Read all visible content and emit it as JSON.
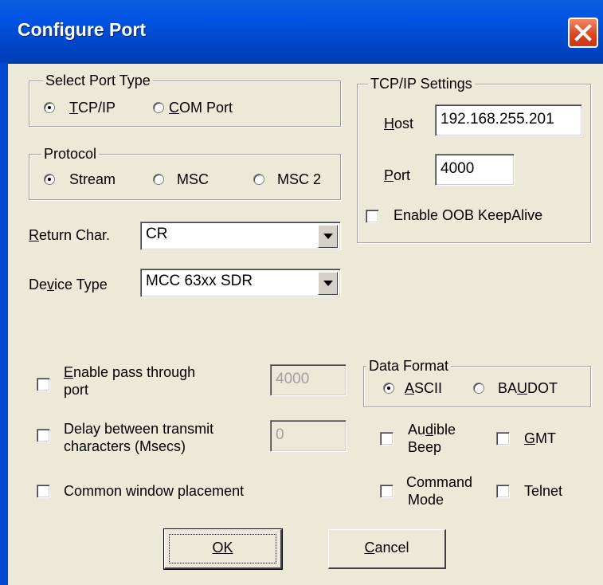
{
  "window": {
    "title": "Configure Port"
  },
  "port_type": {
    "legend": "Select Port Type",
    "options": [
      "TCP/IP",
      "COM Port"
    ],
    "selected": "TCP/IP"
  },
  "protocol": {
    "legend": "Protocol",
    "options": [
      "Stream",
      "MSC",
      "MSC 2"
    ],
    "selected": "Stream"
  },
  "return_char": {
    "label": "Return Char.",
    "value": "CR"
  },
  "device_type": {
    "label": "Device Type",
    "value": "MCC 63xx SDR"
  },
  "tcpip": {
    "legend": "TCP/IP Settings",
    "host_label": "Host",
    "host_value": "192.168.255.201",
    "port_label": "Port",
    "port_value": "4000",
    "oob_label": "Enable OOB KeepAlive",
    "oob_checked": false
  },
  "pass_through": {
    "label_line1": "Enable pass through",
    "label_line2": "port",
    "checked": false,
    "value": "4000"
  },
  "delay": {
    "label_line1": "Delay between transmit",
    "label_line2": "characters (Msecs)",
    "checked": false,
    "value": "0"
  },
  "common_window": {
    "label": "Common window placement",
    "checked": false
  },
  "data_format": {
    "legend": "Data Format",
    "options": [
      "ASCII",
      "BAUDOT"
    ],
    "selected": "ASCII"
  },
  "audible_beep": {
    "label_line1": "Audible",
    "label_line2": "Beep",
    "checked": false
  },
  "gmt": {
    "label": "GMT",
    "checked": false
  },
  "command_mode": {
    "label_line1": "Command",
    "label_line2": "Mode",
    "checked": false
  },
  "telnet": {
    "label": "Telnet",
    "checked": false
  },
  "buttons": {
    "ok": "OK",
    "cancel": "Cancel"
  },
  "colors": {
    "titlebar": "#0054e3",
    "dialog_bg": "#ece9d8",
    "close_button": "#d8431c"
  }
}
